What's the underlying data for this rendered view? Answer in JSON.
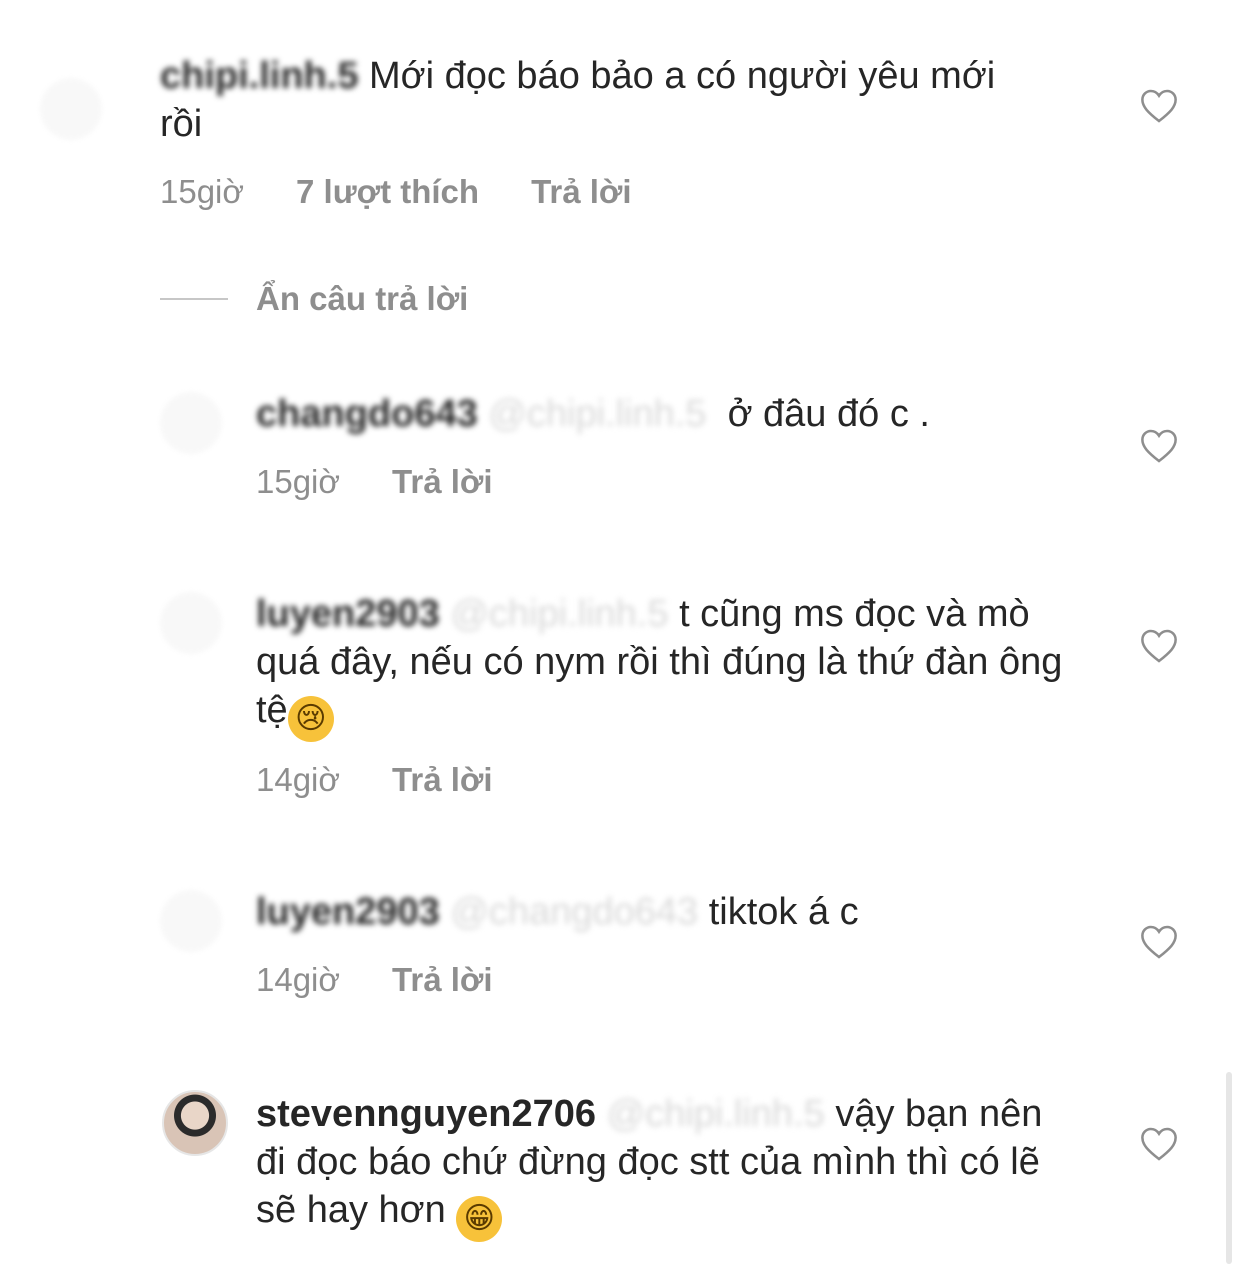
{
  "hide_replies_label": "Ẩn câu trả lời",
  "comments": [
    {
      "username": "chipi.linh.5",
      "mention": "",
      "text": "Mới đọc báo bảo a có người yêu mới rồi",
      "time": "15giờ",
      "likes": "7 lượt thích",
      "reply_label": "Trả lời"
    },
    {
      "username": "changdo643",
      "mention": "@chipi.linh.5",
      "text": "ở đâu đó c .",
      "time": "15giờ",
      "likes": "",
      "reply_label": "Trả lời"
    },
    {
      "username": "luyen2903",
      "mention": "@chipi.linh.5",
      "text": "t cũng ms đọc và mò quá đây, nếu có nym rồi thì đúng là thứ đàn ông tệ",
      "time": "14giờ",
      "likes": "",
      "reply_label": "Trả lời"
    },
    {
      "username": "luyen2903",
      "mention": "@changdo643",
      "text": "tiktok á c",
      "time": "14giờ",
      "likes": "",
      "reply_label": "Trả lời"
    },
    {
      "username": "stevennguyen2706",
      "mention": "@chipi.linh.5",
      "text": "vậy bạn nên đi đọc báo chứ đừng đọc stt của mình thì có lẽ sẽ hay hơn",
      "time": "",
      "likes": "",
      "reply_label": ""
    }
  ],
  "icons": {
    "heart": "heart-outline-icon",
    "crying_emoji": "😢",
    "grin_emoji": "😁"
  },
  "colors": {
    "text": "#262626",
    "meta": "#8e8e8e",
    "blurred": "#d9d9d9"
  }
}
